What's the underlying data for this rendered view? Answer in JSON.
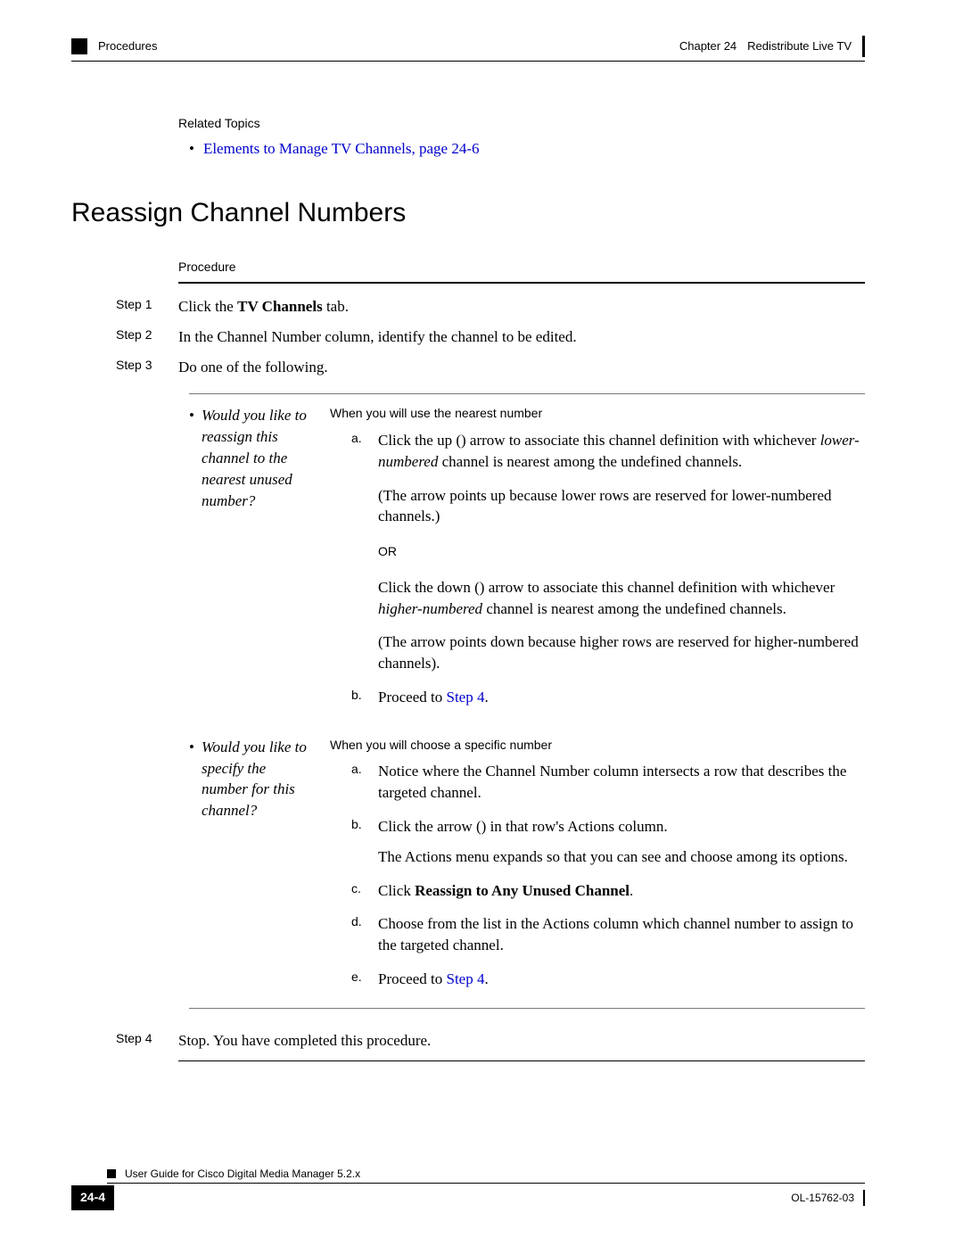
{
  "header": {
    "left_label": "Procedures",
    "right_chapter": "Chapter 24",
    "right_title": "Redistribute Live TV"
  },
  "related": {
    "title": "Related Topics",
    "item": "Elements to Manage TV Channels, page 24-6"
  },
  "section_title": "Reassign Channel Numbers",
  "procedure_label": "Procedure",
  "steps": {
    "s1_label": "Step 1",
    "s1_pre": "Click the ",
    "s1_bold": "TV Channels",
    "s1_post": " tab.",
    "s2_label": "Step 2",
    "s2_text": "In the Channel Number column, identify the channel to be edited.",
    "s3_label": "Step 3",
    "s3_text": "Do one of the following.",
    "s4_label": "Step 4",
    "s4_text": "Stop. You have completed this procedure."
  },
  "option1": {
    "question": "Would you like to reassign this channel to the nearest unused number?",
    "when": "When you will use the nearest number",
    "a_label": "a.",
    "a_p1_pre": "Click the up (",
    "a_p1_mid": ") arrow to associate this channel definition with whichever ",
    "a_p1_italic": "lower-numbered",
    "a_p1_post": " channel is nearest among the undefined channels.",
    "a_p2": "(The arrow points up because lower rows are reserved for lower-numbered channels.)",
    "or": "OR",
    "a_p3_pre": "Click the down (",
    "a_p3_mid": ") arrow to associate this channel definition with whichever ",
    "a_p3_italic": "higher-numbered",
    "a_p3_post": " channel is nearest among the undefined channels.",
    "a_p4": "(The arrow points down because higher rows are reserved for higher-numbered channels).",
    "b_label": "b.",
    "b_pre": "Proceed to ",
    "b_link": "Step 4",
    "b_post": "."
  },
  "option2": {
    "question": "Would you like to specify the number for this channel?",
    "when": "When you will choose a specific number",
    "a_label": "a.",
    "a_text": "Notice where the Channel Number column intersects a row that describes the targeted channel.",
    "b_label": "b.",
    "b_p1_pre": "Click the arrow (",
    "b_p1_post": ") in that row's Actions column.",
    "b_p2": "The Actions menu expands so that you can see and choose among its options.",
    "c_label": "c.",
    "c_pre": "Click ",
    "c_bold": "Reassign to Any Unused Channel",
    "c_post": ".",
    "d_label": "d.",
    "d_text": "Choose from the list in the Actions column which channel number to assign to the targeted channel.",
    "e_label": "e.",
    "e_pre": "Proceed to ",
    "e_link": "Step 4",
    "e_post": "."
  },
  "footer": {
    "guide": "User Guide for Cisco Digital Media Manager 5.2.x",
    "page": "24-4",
    "doc_id": "OL-15762-03"
  }
}
